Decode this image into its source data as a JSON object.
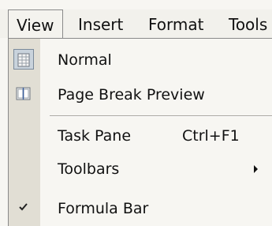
{
  "menubar": {
    "items": [
      {
        "label": "View"
      },
      {
        "label": "Insert"
      },
      {
        "label": "Format"
      },
      {
        "label": "Tools"
      }
    ]
  },
  "view_menu": {
    "items": [
      {
        "label": "Normal",
        "icon": "normal-view-icon",
        "checked": true
      },
      {
        "label": "Page Break Preview",
        "icon": "page-break-preview-icon",
        "checked": false
      },
      {
        "label": "Task Pane",
        "shortcut": "Ctrl+F1"
      },
      {
        "label": "Toolbars",
        "has_submenu": true
      },
      {
        "label": "Formula Bar",
        "icon": "checkmark-icon",
        "checked": true
      }
    ]
  },
  "colors": {
    "menu_background": "#f7f6f2",
    "icon_strip": "#e1ded4",
    "icon_highlight": "#c9d3dc",
    "text": "#111111"
  }
}
